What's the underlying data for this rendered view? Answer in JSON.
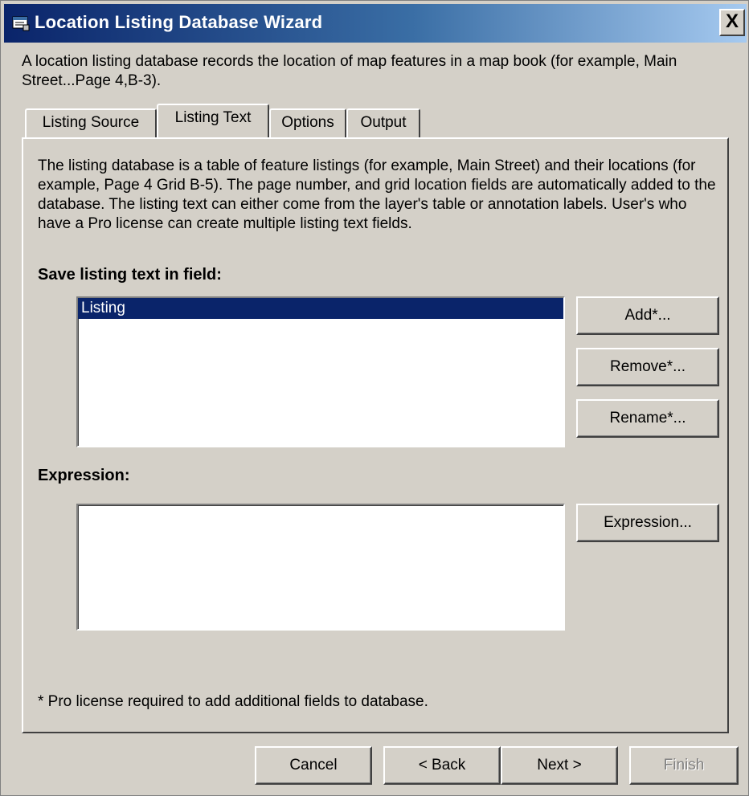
{
  "window": {
    "title": "Location Listing Database Wizard",
    "close_label": "X",
    "intro": "A location listing database records the location of map features in a map book (for example, Main Street...Page 4,B-3)."
  },
  "tabs": [
    {
      "label": "Listing Source",
      "active": false
    },
    {
      "label": "Listing Text",
      "active": true
    },
    {
      "label": "Options",
      "active": false
    },
    {
      "label": "Output",
      "active": false
    }
  ],
  "panel": {
    "description": "The listing database is a table of feature listings (for example, Main Street) and their locations (for example, Page 4 Grid B-5).  The page number, and grid location fields are automatically added to the database.  The listing text can either come from the layer's table or annotation labels.  User's who have a Pro license can create multiple listing text fields.",
    "save_label": "Save listing text in field:",
    "fields": [
      {
        "label": "Listing",
        "selected": true
      }
    ],
    "buttons": {
      "add": "Add*...",
      "remove": "Remove*...",
      "rename": "Rename*..."
    },
    "expression_label": "Expression:",
    "expression_value": "",
    "expression_button": "Expression...",
    "footnote": "* Pro license required to add additional fields to database."
  },
  "footer": {
    "cancel": "Cancel",
    "back": "< Back",
    "next": "Next >",
    "finish": "Finish",
    "finish_enabled": false
  },
  "colors": {
    "face": "#d4d0c8",
    "titlebar_start": "#0a246a",
    "titlebar_end": "#a6caf0",
    "selection": "#0a246a"
  }
}
